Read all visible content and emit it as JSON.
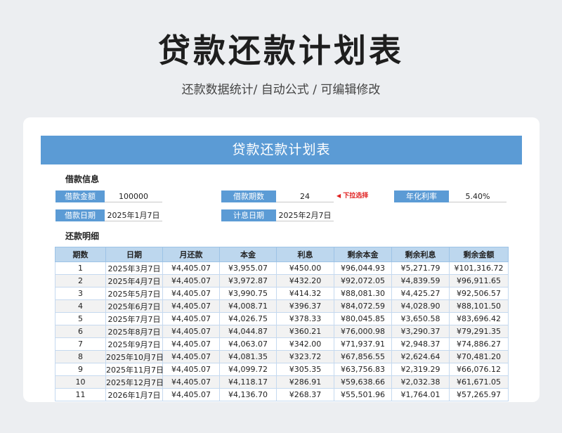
{
  "header": {
    "title": "贷款还款计划表",
    "subtitle": "还款数据统计/ 自动公式 / 可编辑修改"
  },
  "sheet": {
    "title": "贷款还款计划表",
    "loan_section": "借款信息",
    "fields": {
      "amount_label": "借款金额",
      "amount_value": "100000",
      "periods_label": "借款期数",
      "periods_value": "24",
      "periods_hint": "下拉选择",
      "rate_label": "年化利率",
      "rate_value": "5.40%",
      "loan_date_label": "借款日期",
      "loan_date_value": "2025年1月7日",
      "interest_date_label": "计息日期",
      "interest_date_value": "2025年2月7日"
    },
    "repay_section": "还款明细",
    "columns": [
      "期数",
      "日期",
      "月还款",
      "本金",
      "利息",
      "剩余本金",
      "剩余利息",
      "剩余金额"
    ],
    "rows": [
      [
        "1",
        "2025年3月7日",
        "¥4,405.07",
        "¥3,955.07",
        "¥450.00",
        "¥96,044.93",
        "¥5,271.79",
        "¥101,316.72"
      ],
      [
        "2",
        "2025年4月7日",
        "¥4,405.07",
        "¥3,972.87",
        "¥432.20",
        "¥92,072.05",
        "¥4,839.59",
        "¥96,911.65"
      ],
      [
        "3",
        "2025年5月7日",
        "¥4,405.07",
        "¥3,990.75",
        "¥414.32",
        "¥88,081.30",
        "¥4,425.27",
        "¥92,506.57"
      ],
      [
        "4",
        "2025年6月7日",
        "¥4,405.07",
        "¥4,008.71",
        "¥396.37",
        "¥84,072.59",
        "¥4,028.90",
        "¥88,101.50"
      ],
      [
        "5",
        "2025年7月7日",
        "¥4,405.07",
        "¥4,026.75",
        "¥378.33",
        "¥80,045.85",
        "¥3,650.58",
        "¥83,696.42"
      ],
      [
        "6",
        "2025年8月7日",
        "¥4,405.07",
        "¥4,044.87",
        "¥360.21",
        "¥76,000.98",
        "¥3,290.37",
        "¥79,291.35"
      ],
      [
        "7",
        "2025年9月7日",
        "¥4,405.07",
        "¥4,063.07",
        "¥342.00",
        "¥71,937.91",
        "¥2,948.37",
        "¥74,886.27"
      ],
      [
        "8",
        "2025年10月7日",
        "¥4,405.07",
        "¥4,081.35",
        "¥323.72",
        "¥67,856.55",
        "¥2,624.64",
        "¥70,481.20"
      ],
      [
        "9",
        "2025年11月7日",
        "¥4,405.07",
        "¥4,099.72",
        "¥305.35",
        "¥63,756.83",
        "¥2,319.29",
        "¥66,076.12"
      ],
      [
        "10",
        "2025年12月7日",
        "¥4,405.07",
        "¥4,118.17",
        "¥286.91",
        "¥59,638.66",
        "¥2,032.38",
        "¥61,671.05"
      ],
      [
        "11",
        "2026年1月7日",
        "¥4,405.07",
        "¥4,136.70",
        "¥268.37",
        "¥55,501.96",
        "¥1,764.01",
        "¥57,265.97"
      ]
    ]
  }
}
